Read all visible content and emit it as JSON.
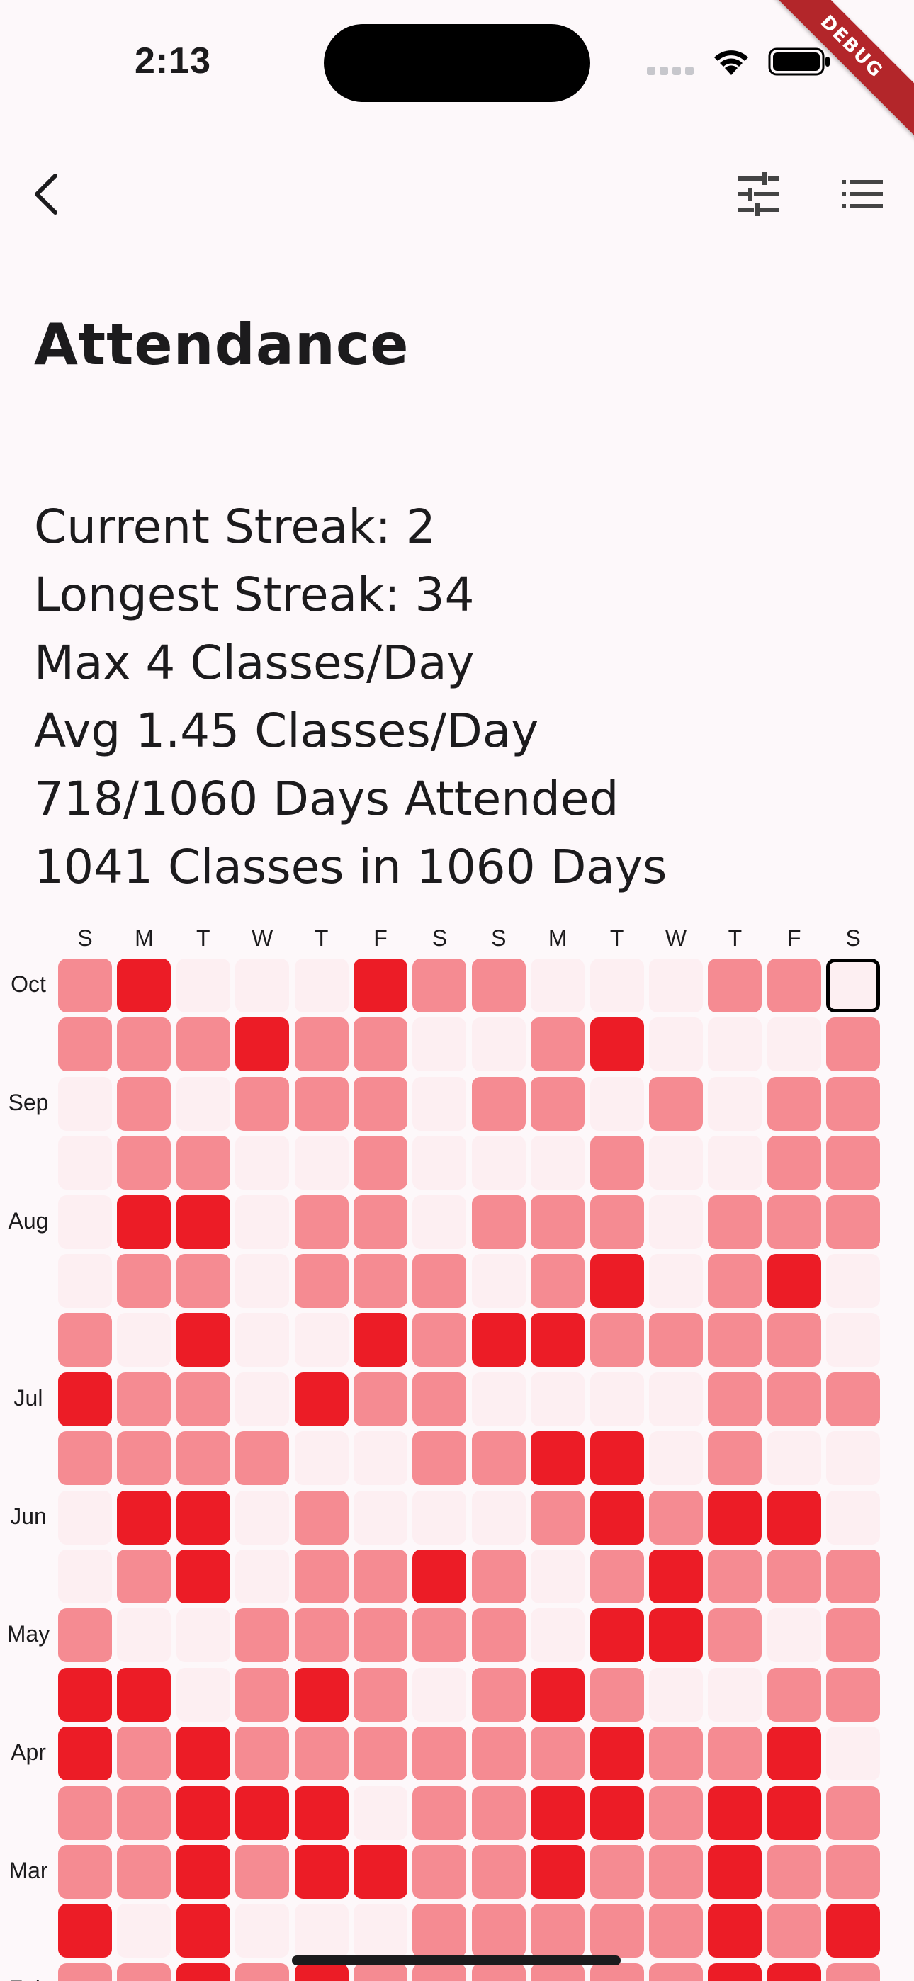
{
  "status_bar": {
    "time": "2:13",
    "icons": [
      "cellular-signal-icon",
      "wifi-icon",
      "battery-icon"
    ]
  },
  "debug_banner": "DEBUG",
  "app_bar": {
    "back_icon": "chevron-left-icon",
    "actions": [
      "tune-filter-icon",
      "list-view-icon"
    ]
  },
  "page": {
    "title": "Attendance",
    "stats": [
      "Current Streak: 2",
      "Longest Streak: 34",
      "Max 4 Classes/Day",
      "Avg 1.45 Classes/Day",
      "718/1060 Days Attended",
      "1041 Classes in 1060 Days"
    ]
  },
  "heatmap": {
    "weekday_labels": [
      "S",
      "M",
      "T",
      "W",
      "T",
      "F",
      "S",
      "S",
      "M",
      "T",
      "W",
      "T",
      "F",
      "S"
    ],
    "month_labels": [
      {
        "label": "Oct",
        "row": 0
      },
      {
        "label": "Sep",
        "row": 2
      },
      {
        "label": "Aug",
        "row": 4
      },
      {
        "label": "Jul",
        "row": 7
      },
      {
        "label": "Jun",
        "row": 9
      },
      {
        "label": "May",
        "row": 11
      },
      {
        "label": "Apr",
        "row": 13
      },
      {
        "label": "Mar",
        "row": 15
      },
      {
        "label": "Feb",
        "row": 17
      }
    ],
    "colors": {
      "none": "#fdeff2",
      "some": "#f58b92",
      "many": "#ec1c26"
    },
    "today": {
      "row": 0,
      "col": 13
    },
    "rows": [
      [
        1,
        2,
        0,
        0,
        0,
        2,
        1,
        1,
        0,
        0,
        0,
        1,
        1,
        0
      ],
      [
        1,
        1,
        1,
        2,
        1,
        1,
        0,
        0,
        1,
        2,
        0,
        0,
        0,
        1
      ],
      [
        0,
        1,
        0,
        1,
        1,
        1,
        0,
        1,
        1,
        0,
        1,
        0,
        1,
        1
      ],
      [
        0,
        1,
        1,
        0,
        0,
        1,
        0,
        0,
        0,
        1,
        0,
        0,
        1,
        1
      ],
      [
        0,
        2,
        2,
        0,
        1,
        1,
        0,
        1,
        1,
        1,
        0,
        1,
        1,
        1
      ],
      [
        0,
        1,
        1,
        0,
        1,
        1,
        1,
        0,
        1,
        2,
        0,
        1,
        2,
        0
      ],
      [
        1,
        0,
        2,
        0,
        0,
        2,
        1,
        2,
        2,
        1,
        1,
        1,
        1,
        0
      ],
      [
        2,
        1,
        1,
        0,
        2,
        1,
        1,
        0,
        0,
        0,
        0,
        1,
        1,
        1
      ],
      [
        1,
        1,
        1,
        1,
        0,
        0,
        1,
        1,
        2,
        2,
        0,
        1,
        0,
        0
      ],
      [
        0,
        2,
        2,
        0,
        1,
        0,
        0,
        0,
        1,
        2,
        1,
        2,
        2,
        0
      ],
      [
        0,
        1,
        2,
        0,
        1,
        1,
        2,
        1,
        0,
        1,
        2,
        1,
        1,
        1
      ],
      [
        1,
        0,
        0,
        1,
        1,
        1,
        1,
        1,
        0,
        2,
        2,
        1,
        0,
        1
      ],
      [
        2,
        2,
        0,
        1,
        2,
        1,
        0,
        1,
        2,
        1,
        0,
        0,
        1,
        1
      ],
      [
        2,
        1,
        2,
        1,
        1,
        1,
        1,
        1,
        1,
        2,
        1,
        1,
        2,
        0
      ],
      [
        1,
        1,
        2,
        2,
        2,
        0,
        1,
        1,
        2,
        2,
        1,
        2,
        2,
        1
      ],
      [
        1,
        1,
        2,
        1,
        2,
        2,
        1,
        1,
        2,
        1,
        1,
        2,
        1,
        1
      ],
      [
        2,
        0,
        2,
        0,
        0,
        0,
        1,
        1,
        1,
        1,
        1,
        2,
        1,
        2
      ],
      [
        1,
        1,
        2,
        1,
        2,
        1,
        1,
        1,
        1,
        1,
        1,
        2,
        2,
        1
      ]
    ]
  }
}
